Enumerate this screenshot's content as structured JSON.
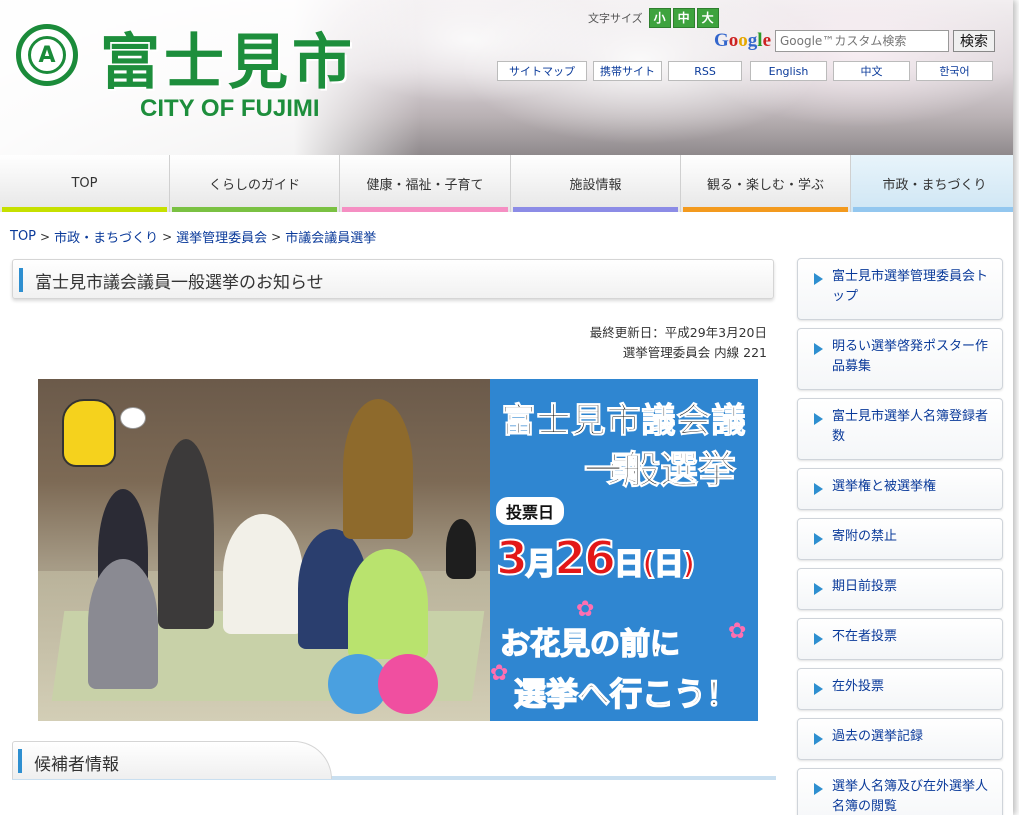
{
  "header": {
    "logo_mark": "A",
    "title_jp": "富士見市",
    "title_en": "CITY OF FUJIMI",
    "font_size_label": "文字サイズ",
    "font_sizes": [
      "小",
      "中",
      "大"
    ],
    "google_logo": "Google",
    "search_placeholder": "Google™カスタム検索",
    "search_button": "検索",
    "util_links": [
      "サイトマップ",
      "携帯サイト",
      "RSS"
    ],
    "lang_links": [
      "English",
      "中文",
      "한국어"
    ]
  },
  "nav": {
    "items": [
      {
        "label": "TOP",
        "color": "#c6e000"
      },
      {
        "label": "くらしのガイド",
        "color": "#7ac142"
      },
      {
        "label": "健康・福祉・子育て",
        "color": "#f58fc3"
      },
      {
        "label": "施設情報",
        "color": "#8c8ce6"
      },
      {
        "label": "観る・楽しむ・学ぶ",
        "color": "#f39a1e"
      },
      {
        "label": "市政・まちづくり",
        "color": "#93c7ef"
      }
    ]
  },
  "breadcrumb": {
    "items": [
      "TOP",
      "市政・まちづくり",
      "選挙管理委員会",
      "市議会議員選挙"
    ],
    "separator": ">"
  },
  "main": {
    "page_title": "富士見市議会議員一般選挙のお知らせ",
    "last_updated": "最終更新日：平成29年3月20日",
    "department": "選挙管理委員会 内線 221",
    "banner": {
      "title_line1": "富士見市議会議員",
      "title_line2": "一般選挙",
      "vote_day_label": "投票日",
      "vote_date_month": "3",
      "vote_date_month_unit": "月",
      "vote_date_day": "26",
      "vote_date_day_unit": "日",
      "vote_date_weekday": "(日)",
      "slogan_line1": "お花見の前に",
      "slogan_line2": "選挙へ行こう！"
    },
    "section_title": "候補者情報"
  },
  "sidebar": {
    "items": [
      "富士見市選挙管理委員会トップ",
      "明るい選挙啓発ポスター作品募集",
      "富士見市選挙人名簿登録者数",
      "選挙権と被選挙権",
      "寄附の禁止",
      "期日前投票",
      "不在者投票",
      "在外投票",
      "過去の選挙記録",
      "選挙人名簿及び在外選挙人名簿の閲覧"
    ]
  }
}
